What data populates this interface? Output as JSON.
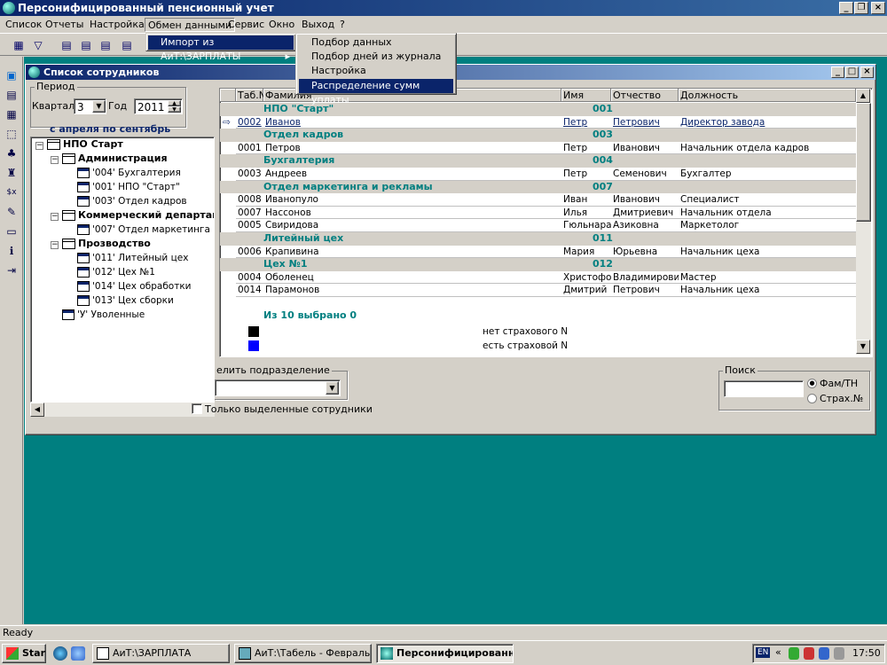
{
  "app": {
    "title": "Персонифицированный пенсионный учет"
  },
  "menubar": [
    "Список",
    "Отчеты",
    "Настройка",
    "Обмен данными",
    "Сервис",
    "Окно",
    "Выход",
    "?"
  ],
  "submenu": {
    "import_label": "Импорт из АиТ:\\ЗАРПЛАТЫ"
  },
  "flyout": [
    "Подбор данных",
    "Подбор дней из журнала",
    "Настройка",
    "Распределение сумм уплаты"
  ],
  "window": {
    "title": "Список сотрудников"
  },
  "period": {
    "legend": "Период",
    "quarter_label": "Квартал",
    "quarter_value": "3",
    "year_label": "Год",
    "year_value": "2011",
    "range_text": "с апреля по сентябрь"
  },
  "tree": {
    "root": "НПО Старт",
    "admin": "Администрация",
    "admin_items": [
      "'004' Бухгалтерия",
      "'001' НПО \"Старт\"",
      "'003' Отдел кадров"
    ],
    "commerce": "Коммерческий департаме",
    "commerce_items": [
      "'007' Отдел маркетинга и"
    ],
    "production": "Прозводство",
    "production_items": [
      "'011' Литейный цех",
      "'012' Цех №1",
      "'014' Цех обработки",
      "'013' Цех сборки"
    ],
    "dismissed": "'У' Уволенные"
  },
  "grid": {
    "headers": [
      "Таб.N",
      "Фамилия",
      "Имя",
      "Отчество",
      "Должность"
    ],
    "rows": [
      {
        "kind": "dept",
        "name": "НПО \"Старт\"",
        "code": "001"
      },
      {
        "kind": "emp",
        "marker": "⇨",
        "tab": "0002",
        "surname": "Иванов",
        "first": "Петр",
        "patronymic": "Петрович",
        "position": "Директор завода",
        "link": true
      },
      {
        "kind": "dept",
        "name": "Отдел кадров",
        "code": "003"
      },
      {
        "kind": "emp",
        "tab": "0001",
        "surname": "Петров",
        "first": "Петр",
        "patronymic": "Иванович",
        "position": "Начальник отдела кадров"
      },
      {
        "kind": "dept",
        "name": "Бухгалтерия",
        "code": "004"
      },
      {
        "kind": "emp",
        "tab": "0003",
        "surname": "Андреев",
        "first": "Петр",
        "patronymic": "Семенович",
        "position": "Бухгалтер"
      },
      {
        "kind": "dept",
        "name": "Отдел маркетинга и рекламы",
        "code": "007"
      },
      {
        "kind": "emp",
        "tab": "0008",
        "surname": "Иванопуло",
        "first": "Иван",
        "patronymic": "Иванович",
        "position": "Специалист"
      },
      {
        "kind": "emp",
        "tab": "0007",
        "surname": "Нассонов",
        "first": "Илья",
        "patronymic": "Дмитриевич",
        "position": "Начальник отдела"
      },
      {
        "kind": "emp",
        "tab": "0005",
        "surname": "Свиридова",
        "first": "Гюльнара",
        "patronymic": "Азиковна",
        "position": "Маркетолог"
      },
      {
        "kind": "dept",
        "name": "Литейный цех",
        "code": "011"
      },
      {
        "kind": "emp",
        "tab": "0006",
        "surname": "Крапивина",
        "first": "Мария",
        "patronymic": "Юрьевна",
        "position": "Начальник цеха"
      },
      {
        "kind": "dept",
        "name": "Цех №1",
        "code": "012"
      },
      {
        "kind": "emp",
        "tab": "0004",
        "surname": "Оболенец",
        "first": "Христофор",
        "patronymic": "Владимирович",
        "position": "Мастер"
      },
      {
        "kind": "emp",
        "tab": "0014",
        "surname": "Парамонов",
        "first": "Дмитрий",
        "patronymic": "Петрович",
        "position": "Начальник цеха"
      }
    ],
    "summary": "Из 10 выбрано 0",
    "legend_black": "нет страхового N",
    "legend_blue": "есть страховой N"
  },
  "controls": {
    "highlight_label": "елить подразделение",
    "only_selected": "Только выделенные сотрудники",
    "search_legend": "Поиск",
    "radio_fam": "Фам/ТН",
    "radio_strah": "Страх.№"
  },
  "status": "Ready",
  "taskbar": {
    "start": "Start",
    "tasks": [
      "АиТ:\\ЗАРПЛАТА",
      "АиТ:\\Табель - Февраль ...",
      "Персонифицированн..."
    ],
    "lang": "EN",
    "clock": "17:50"
  },
  "colors": {
    "title": "#0a246a",
    "workspace": "#007f80",
    "dept_text": "#007f80"
  }
}
